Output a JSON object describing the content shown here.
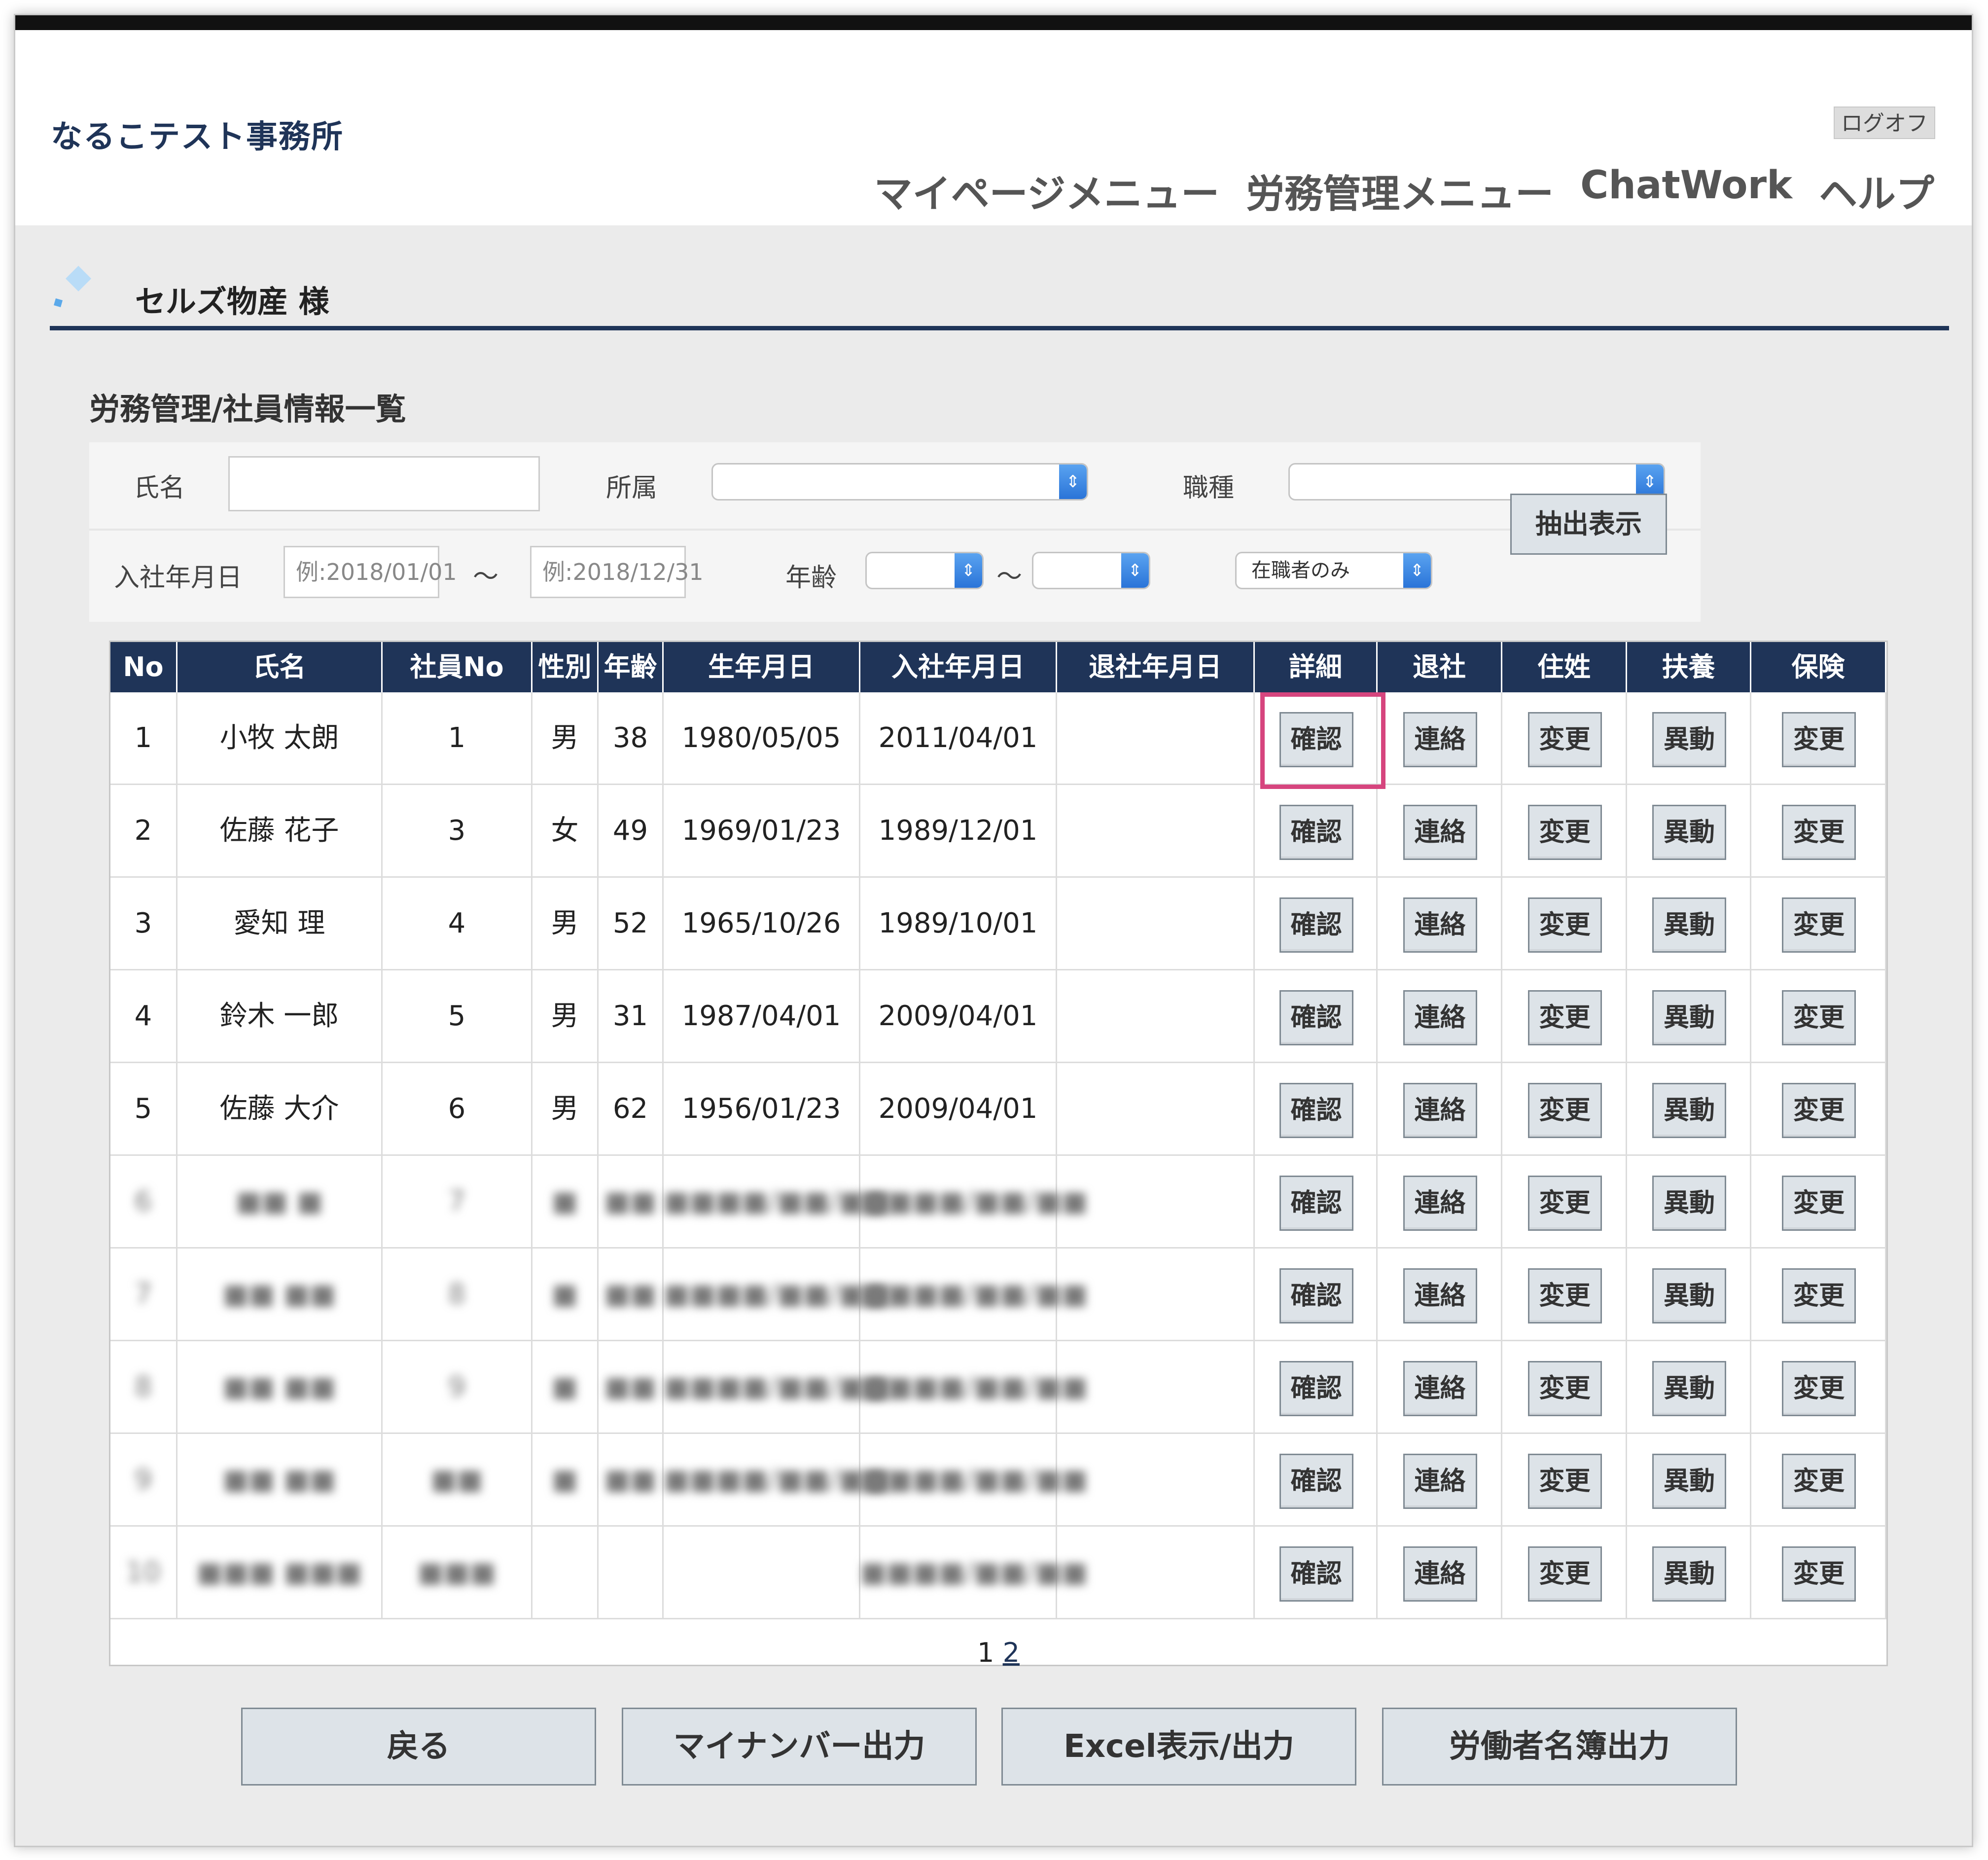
{
  "header": {
    "office_name": "なるこテスト事務所",
    "logoff_label": "ログオフ",
    "nav": [
      "マイページメニュー",
      "労務管理メニュー",
      "ChatWork",
      "ヘルプ"
    ]
  },
  "client": {
    "name": "セルズ物産 様"
  },
  "section_title": "労務管理/社員情報一覧",
  "filter": {
    "name_label": "氏名",
    "name_value": "",
    "dept_label": "所属",
    "dept_value": "",
    "job_label": "職種",
    "job_value": "",
    "hire_date_label": "入社年月日",
    "hire_from_placeholder": "例:2018/01/01",
    "range_sep": "〜",
    "hire_to_placeholder": "例:2018/12/31",
    "age_label": "年齢",
    "age_from": "",
    "age_to": "",
    "status_value": "在職者のみ",
    "extract_button": "抽出表示"
  },
  "table": {
    "headers": [
      "No",
      "氏名",
      "社員No",
      "性別",
      "年齢",
      "生年月日",
      "入社年月日",
      "退社年月日",
      "詳細",
      "退社",
      "住姓",
      "扶養",
      "保険"
    ],
    "action_labels": [
      "確認",
      "連絡",
      "変更",
      "異動",
      "変更"
    ],
    "rows": [
      {
        "no": "1",
        "name": "小牧 太朗",
        "emp_no": "1",
        "gender": "男",
        "age": "38",
        "birth": "1980/05/05",
        "hire": "2011/04/01",
        "leave": ""
      },
      {
        "no": "2",
        "name": "佐藤 花子",
        "emp_no": "3",
        "gender": "女",
        "age": "49",
        "birth": "1969/01/23",
        "hire": "1989/12/01",
        "leave": ""
      },
      {
        "no": "3",
        "name": "愛知 理",
        "emp_no": "4",
        "gender": "男",
        "age": "52",
        "birth": "1965/10/26",
        "hire": "1989/10/01",
        "leave": ""
      },
      {
        "no": "4",
        "name": "鈴木 一郎",
        "emp_no": "5",
        "gender": "男",
        "age": "31",
        "birth": "1987/04/01",
        "hire": "2009/04/01",
        "leave": ""
      },
      {
        "no": "5",
        "name": "佐藤 大介",
        "emp_no": "6",
        "gender": "男",
        "age": "62",
        "birth": "1956/01/23",
        "hire": "2009/04/01",
        "leave": ""
      }
    ],
    "blurred_rows": [
      {
        "no": "6",
        "name": "■■ ■",
        "emp_no": "7",
        "gender": "■",
        "age": "■■",
        "birth": "■■■■/■■/■■",
        "hire": "■■■■/■■/■■"
      },
      {
        "no": "7",
        "name": "■■ ■■",
        "emp_no": "8",
        "gender": "■",
        "age": "■■",
        "birth": "■■■■/■■/■■",
        "hire": "■■■■/■■/■■"
      },
      {
        "no": "8",
        "name": "■■ ■■",
        "emp_no": "9",
        "gender": "■",
        "age": "■■",
        "birth": "■■■■/■■/■■",
        "hire": "■■■■/■■/■■"
      },
      {
        "no": "9",
        "name": "■■ ■■",
        "emp_no": "■■",
        "gender": "■",
        "age": "■■",
        "birth": "■■■■/■■/■■",
        "hire": "■■■■/■■/■■"
      },
      {
        "no": "10",
        "name": "■■■ ■■■",
        "emp_no": "■■■",
        "gender": "",
        "age": "",
        "birth": "",
        "hire": "■■■■/■■/■■"
      }
    ],
    "pagination": {
      "current": "1",
      "next": "2"
    }
  },
  "bottom_buttons": [
    "戻る",
    "マイナンバー出力",
    "Excel表示/出力",
    "労働者名簿出力"
  ],
  "colors": {
    "navy": "#1f3458",
    "highlight": "#d6457e",
    "select_arrow": "#2a74d8"
  }
}
